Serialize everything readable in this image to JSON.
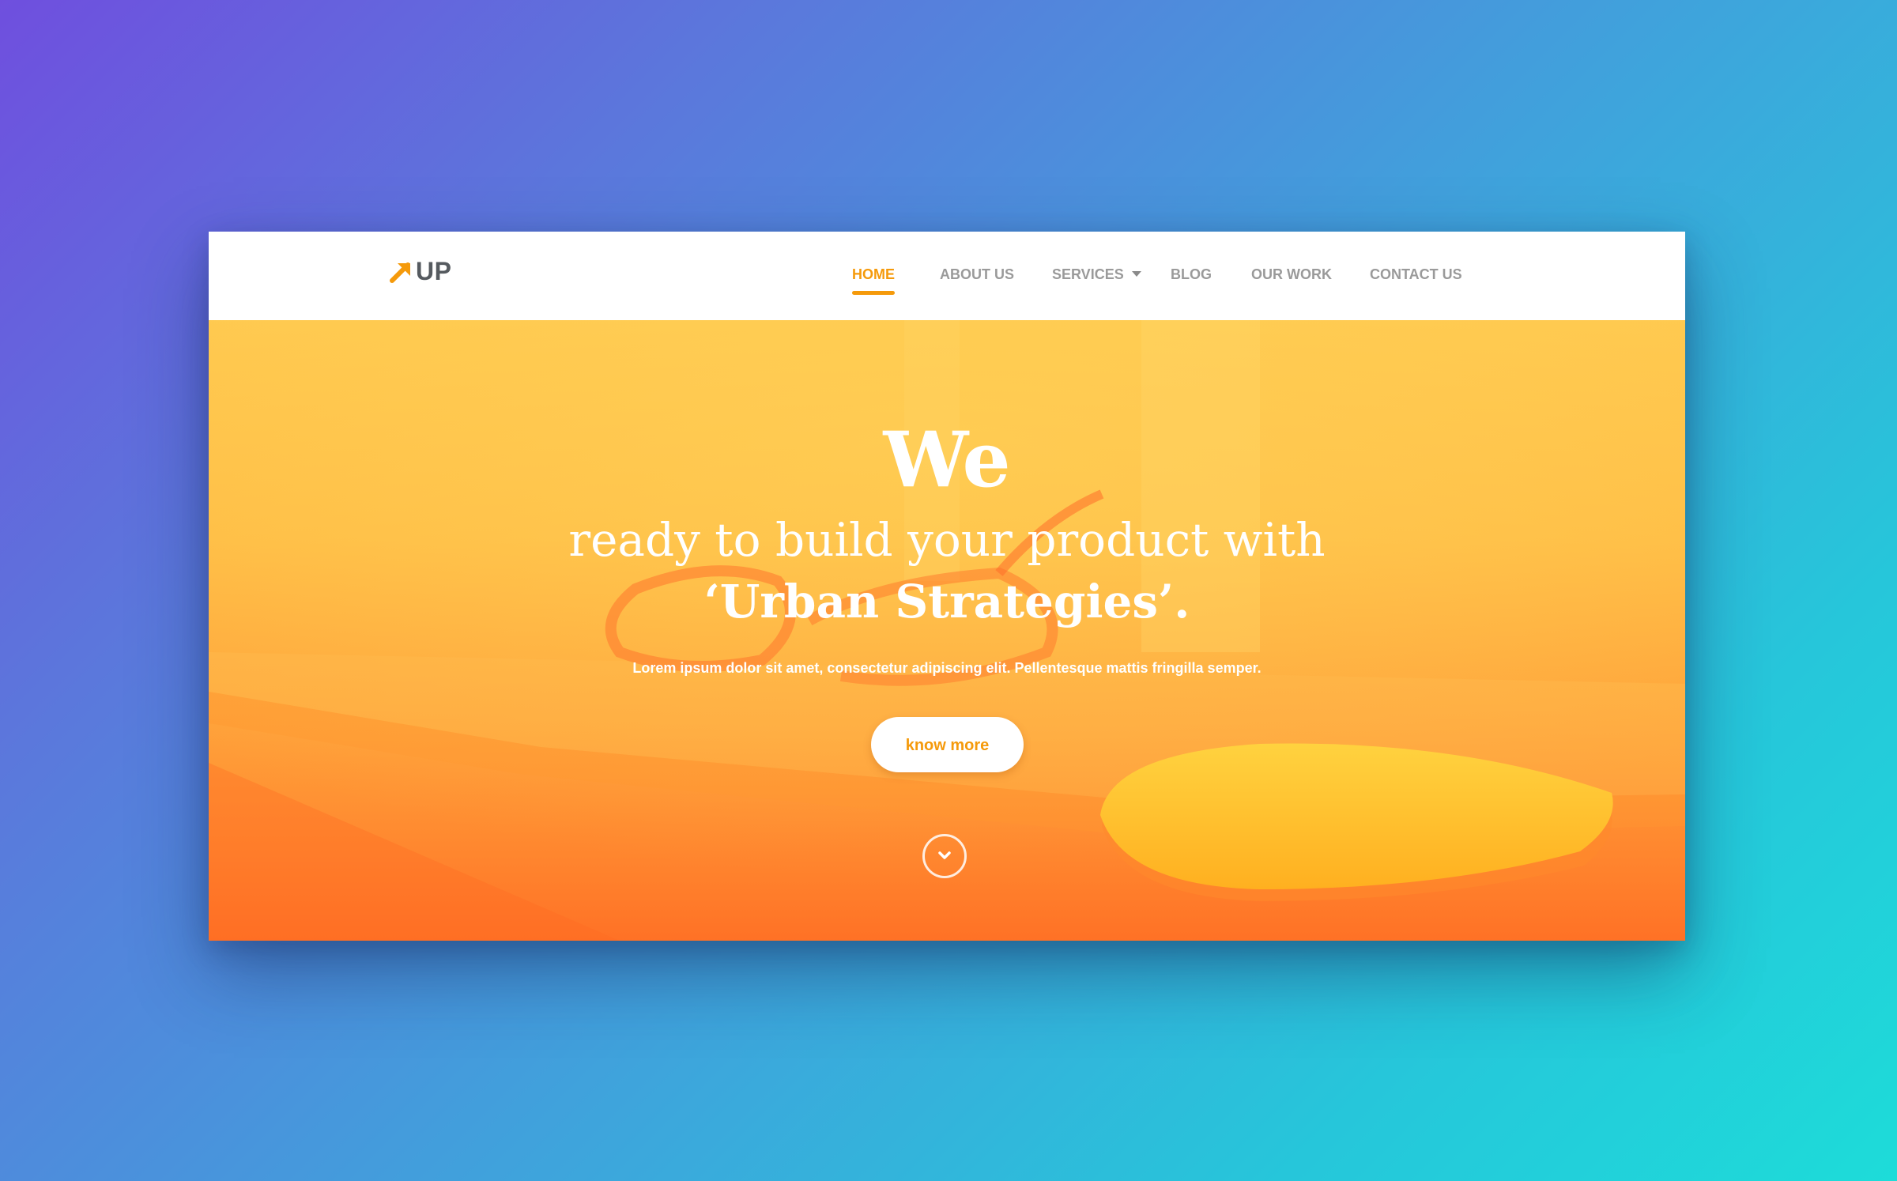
{
  "logo": {
    "text": "UP",
    "icon": "arrow-up-right-icon",
    "color": "#f59a0b"
  },
  "nav": {
    "items": [
      {
        "label": "HOME",
        "active": true
      },
      {
        "label": "ABOUT US",
        "active": false
      },
      {
        "label": "SERVICES",
        "active": false,
        "has_dropdown": true
      },
      {
        "label": "BLOG",
        "active": false
      },
      {
        "label": "OUR WORK",
        "active": false
      },
      {
        "label": "CONTACT US",
        "active": false
      }
    ]
  },
  "hero": {
    "line1": "We",
    "line2": "ready to build your product with",
    "line3": "‘Urban Strategies’.",
    "subtext": "Lorem ipsum dolor sit amet, consectetur adipiscing elit. Pellentesque mattis fringilla semper.",
    "cta_label": "know more",
    "scroll_icon": "chevron-down-circle-icon"
  },
  "colors": {
    "accent": "#f59a0b",
    "nav_text": "#9a9a9a",
    "hero_top": "#ffc84e",
    "hero_bottom": "#ff7a2a",
    "page_gradient_start": "#6f4fde",
    "page_gradient_end": "#1ddcd9"
  }
}
